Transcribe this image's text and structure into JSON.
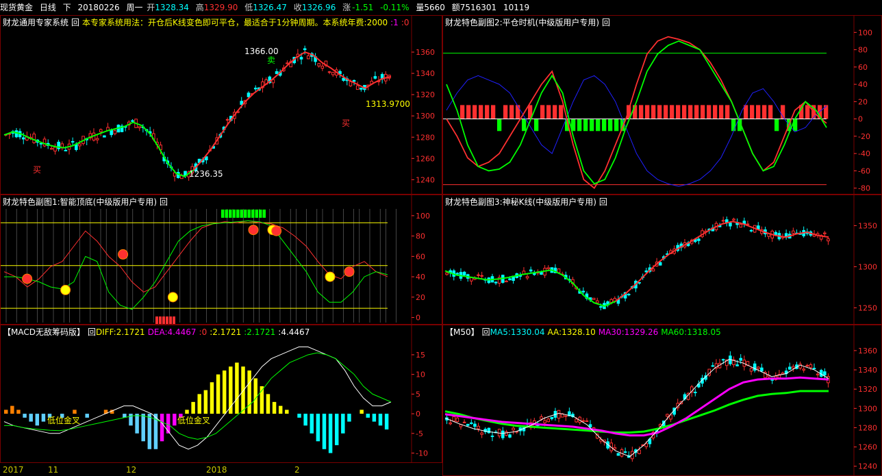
{
  "header": {
    "instrument": "现货黄金",
    "period": "日线",
    "direction": "下",
    "date": "20180226",
    "weekday": "周一",
    "open_label": "开",
    "open": "1328.34",
    "high_label": "高",
    "high": "1329.90",
    "low_label": "低",
    "low": "1326.47",
    "close_label": "收",
    "close": "1326.96",
    "change_label": "涨",
    "change": "-1.51",
    "change_pct": "-0.11%",
    "volume": "量5660",
    "amount": "额7516301",
    "extra": "10119"
  },
  "colors": {
    "up": "#ff3030",
    "down": "#00ffff",
    "green": "#00ff00",
    "yellow": "#ffff00",
    "magenta": "#ff00ff",
    "white": "#ffffff",
    "blue": "#2020ff",
    "grid": "#7a0000",
    "axis": "#ff3030"
  },
  "panels": {
    "main": {
      "title": "财龙通用专家系统",
      "toggle": "回",
      "desc": "本专家系统用法：开仓后K线变色即可平仓，最适合于1分钟周期。本系统年费:2000",
      "v1": ":1",
      "v2": ":0",
      "labels": {
        "high": "1366.00",
        "low": "1236.35",
        "right": "1313.9700",
        "sell": "卖",
        "buy1": "买",
        "buy2": "买"
      }
    },
    "sub1": {
      "title": "财龙特色副图1:智能顶底(中级版用户专用)",
      "toggle": "回"
    },
    "macd": {
      "title": "【MACD无敌筹码版】",
      "toggle": "回",
      "diff_label": "DIFF:2.1721",
      "dea_label": "DEA:4.4467",
      "v0": ":0",
      "v1": ":2.1721",
      "v2": ":2.1721",
      "v3": ":4.4467",
      "annot1": "低位金叉",
      "annot2": "低位金叉"
    },
    "sub2": {
      "title": "财龙特色副图2:平仓时机(中级版用户专用)",
      "toggle": "回"
    },
    "sub3": {
      "title": "财龙特色副图3:神秘K线(中级版用户专用)",
      "toggle": "回"
    },
    "ma": {
      "title": "【M50】",
      "toggle": "回",
      "ma5": "MA5:1330.04",
      "aa": "AA:1328.10",
      "ma30": "MA30:1329.26",
      "ma60": "MA60:1318.05"
    }
  },
  "xaxis": {
    "labels": [
      "2017",
      "11",
      "12",
      "2018",
      "2"
    ],
    "positions": [
      0.0,
      0.11,
      0.3,
      0.495,
      0.71
    ]
  },
  "chart_data": [
    {
      "type": "candlestick",
      "name": "main",
      "ylim": [
        1228,
        1380
      ],
      "yticks": [
        1240,
        1260,
        1280,
        1300,
        1320,
        1340,
        1360
      ],
      "trend": [
        1282,
        1285,
        1283,
        1279,
        1276,
        1273,
        1271,
        1270,
        1272,
        1276,
        1280,
        1283,
        1286,
        1288,
        1290,
        1294,
        1291,
        1283,
        1270,
        1256,
        1246,
        1243,
        1249,
        1258,
        1268,
        1280,
        1292,
        1303,
        1313,
        1321,
        1327,
        1333,
        1340,
        1348,
        1355,
        1360,
        1357,
        1350,
        1345,
        1339,
        1334,
        1330,
        1326,
        1331,
        1335,
        1337
      ],
      "split": 22
    },
    {
      "type": "line",
      "name": "sub1",
      "ylim": [
        -5,
        108
      ],
      "yticks": [
        0,
        20,
        40,
        60,
        80,
        100
      ],
      "hlines": [
        93,
        51,
        9
      ],
      "red": [
        45,
        40,
        30,
        38,
        50,
        55,
        70,
        85,
        75,
        60,
        50,
        35,
        25,
        30,
        45,
        60,
        75,
        88,
        92,
        94,
        93,
        95,
        93,
        92,
        88,
        80,
        70,
        55,
        42,
        38,
        50,
        55,
        45,
        40
      ],
      "green": [
        40,
        40,
        38,
        35,
        30,
        28,
        35,
        60,
        55,
        25,
        12,
        8,
        20,
        35,
        55,
        75,
        85,
        90,
        92,
        93,
        94,
        95,
        94,
        90,
        75,
        60,
        45,
        25,
        15,
        15,
        25,
        40,
        45,
        42
      ],
      "dots": [
        [
          0.06,
          38
        ],
        [
          0.16,
          27
        ],
        [
          0.31,
          62
        ],
        [
          0.44,
          20
        ],
        [
          0.65,
          86
        ],
        [
          0.7,
          86
        ],
        [
          0.71,
          85
        ],
        [
          0.85,
          40
        ],
        [
          0.9,
          45
        ]
      ]
    },
    {
      "type": "bar",
      "name": "macd",
      "ylim": [
        -12,
        19
      ],
      "yticks": [
        -10,
        -5,
        0,
        5,
        10,
        15
      ],
      "hist": [
        1,
        2,
        1,
        -1,
        -2,
        -3,
        -2,
        -1,
        0,
        -1,
        0,
        1,
        0,
        -1,
        0,
        0,
        1,
        1,
        0,
        -1,
        -3,
        -5,
        -7,
        -9,
        -9,
        -7,
        -5,
        -3,
        -1,
        1,
        3,
        5,
        6,
        8,
        10,
        11,
        12,
        13,
        12,
        11,
        9,
        7,
        5,
        3,
        2,
        1,
        0,
        -1,
        -3,
        -5,
        -7,
        -9,
        -10,
        -8,
        -5,
        -2,
        0,
        1,
        -1,
        -2,
        -3,
        -4
      ],
      "diff": [
        -2,
        -3,
        -3.5,
        -4,
        -4.5,
        -5,
        -5,
        -4,
        -3,
        -2,
        -1,
        0,
        1,
        2,
        2,
        1,
        0,
        -2,
        -5,
        -8,
        -9,
        -8,
        -6,
        -3,
        0,
        3,
        6,
        9,
        12,
        14,
        15,
        16,
        17,
        17,
        16,
        15,
        14,
        11,
        7,
        4,
        2,
        2,
        3
      ],
      "dea": [
        -3,
        -3,
        -3.5,
        -3.8,
        -4,
        -4.2,
        -4.3,
        -4,
        -3.5,
        -3,
        -2.5,
        -2,
        -1.5,
        -1,
        -0.5,
        -0.5,
        -1,
        -2,
        -3,
        -5,
        -6,
        -6.5,
        -6,
        -5,
        -3,
        -1,
        1,
        3,
        6,
        9,
        11,
        13,
        14,
        15,
        15.5,
        15,
        14,
        12,
        10,
        7,
        5,
        4,
        3
      ]
    },
    {
      "type": "line",
      "name": "sub2",
      "ylim": [
        -85,
        105
      ],
      "yticks": [
        -80,
        -60,
        -40,
        -20,
        0,
        20,
        40,
        60,
        80,
        100
      ],
      "green_line": 76,
      "red_line": -76,
      "green": [
        40,
        10,
        -30,
        -55,
        -60,
        -58,
        -50,
        -30,
        0,
        30,
        50,
        30,
        -20,
        -60,
        -75,
        -70,
        -45,
        -10,
        20,
        55,
        75,
        85,
        90,
        85,
        80,
        60,
        40,
        20,
        -10,
        -40,
        -60,
        -55,
        -30,
        0,
        20,
        10,
        -10
      ],
      "red": [
        0,
        -20,
        -45,
        -55,
        -50,
        -40,
        -20,
        0,
        20,
        40,
        55,
        20,
        -30,
        -70,
        -80,
        -60,
        -30,
        0,
        40,
        75,
        90,
        95,
        92,
        88,
        80,
        65,
        45,
        20,
        -10,
        -40,
        -60,
        -50,
        -20,
        10,
        20,
        5,
        -5
      ],
      "blue": [
        10,
        30,
        45,
        50,
        45,
        40,
        30,
        10,
        -10,
        -30,
        -40,
        -10,
        20,
        45,
        50,
        40,
        20,
        -10,
        -40,
        -60,
        -70,
        -75,
        -78,
        -75,
        -70,
        -60,
        -45,
        -20,
        10,
        30,
        35,
        20,
        0,
        -15,
        -10,
        5,
        15
      ],
      "bars": [
        1,
        1,
        1,
        1,
        1,
        1,
        -1,
        1,
        1,
        1,
        -1,
        1,
        -1,
        1,
        1,
        1,
        1,
        -1,
        -1,
        -1,
        -1,
        -1,
        -1,
        -1,
        -1,
        -1,
        -1,
        1,
        1,
        1,
        1,
        1,
        1,
        1,
        1,
        1,
        1,
        1,
        1,
        1,
        1,
        1,
        1,
        1,
        -1,
        -1,
        1,
        1,
        1,
        1,
        1,
        -1,
        1,
        -1,
        -1,
        1,
        1,
        1,
        1,
        1
      ]
    },
    {
      "type": "candlestick",
      "name": "sub3",
      "ylim": [
        1232,
        1372
      ],
      "yticks": [
        1250,
        1300,
        1350
      ],
      "trend": [
        1295,
        1290,
        1288,
        1286,
        1284,
        1285,
        1287,
        1290,
        1292,
        1294,
        1296,
        1290,
        1280,
        1265,
        1256,
        1252,
        1258,
        1268,
        1280,
        1293,
        1305,
        1315,
        1323,
        1330,
        1338,
        1346,
        1352,
        1355,
        1352,
        1347,
        1342,
        1338,
        1336,
        1340,
        1342,
        1338,
        1336
      ],
      "split": 16
    },
    {
      "type": "line",
      "name": "ma",
      "ylim": [
        1232,
        1372
      ],
      "yticks": [
        1240,
        1260,
        1280,
        1300,
        1320,
        1340,
        1360
      ],
      "ma5": [
        1290,
        1284,
        1279,
        1276,
        1274,
        1276,
        1282,
        1290,
        1295,
        1292,
        1283,
        1268,
        1256,
        1250,
        1262,
        1278,
        1296,
        1312,
        1328,
        1342,
        1351,
        1347,
        1340,
        1333,
        1336,
        1345,
        1340,
        1331
      ],
      "ma30": [
        1294,
        1292,
        1290,
        1288,
        1286,
        1285,
        1284,
        1283,
        1282,
        1281,
        1279,
        1277,
        1274,
        1272,
        1272,
        1275,
        1282,
        1290,
        1300,
        1310,
        1320,
        1327,
        1330,
        1331,
        1331,
        1332,
        1331,
        1330
      ],
      "ma60": [
        1297,
        1294,
        1290,
        1287,
        1284,
        1282,
        1281,
        1280,
        1279,
        1278,
        1277,
        1276,
        1275,
        1275,
        1276,
        1279,
        1283,
        1288,
        1293,
        1298,
        1304,
        1309,
        1313,
        1315,
        1316,
        1318,
        1318,
        1318
      ]
    }
  ]
}
